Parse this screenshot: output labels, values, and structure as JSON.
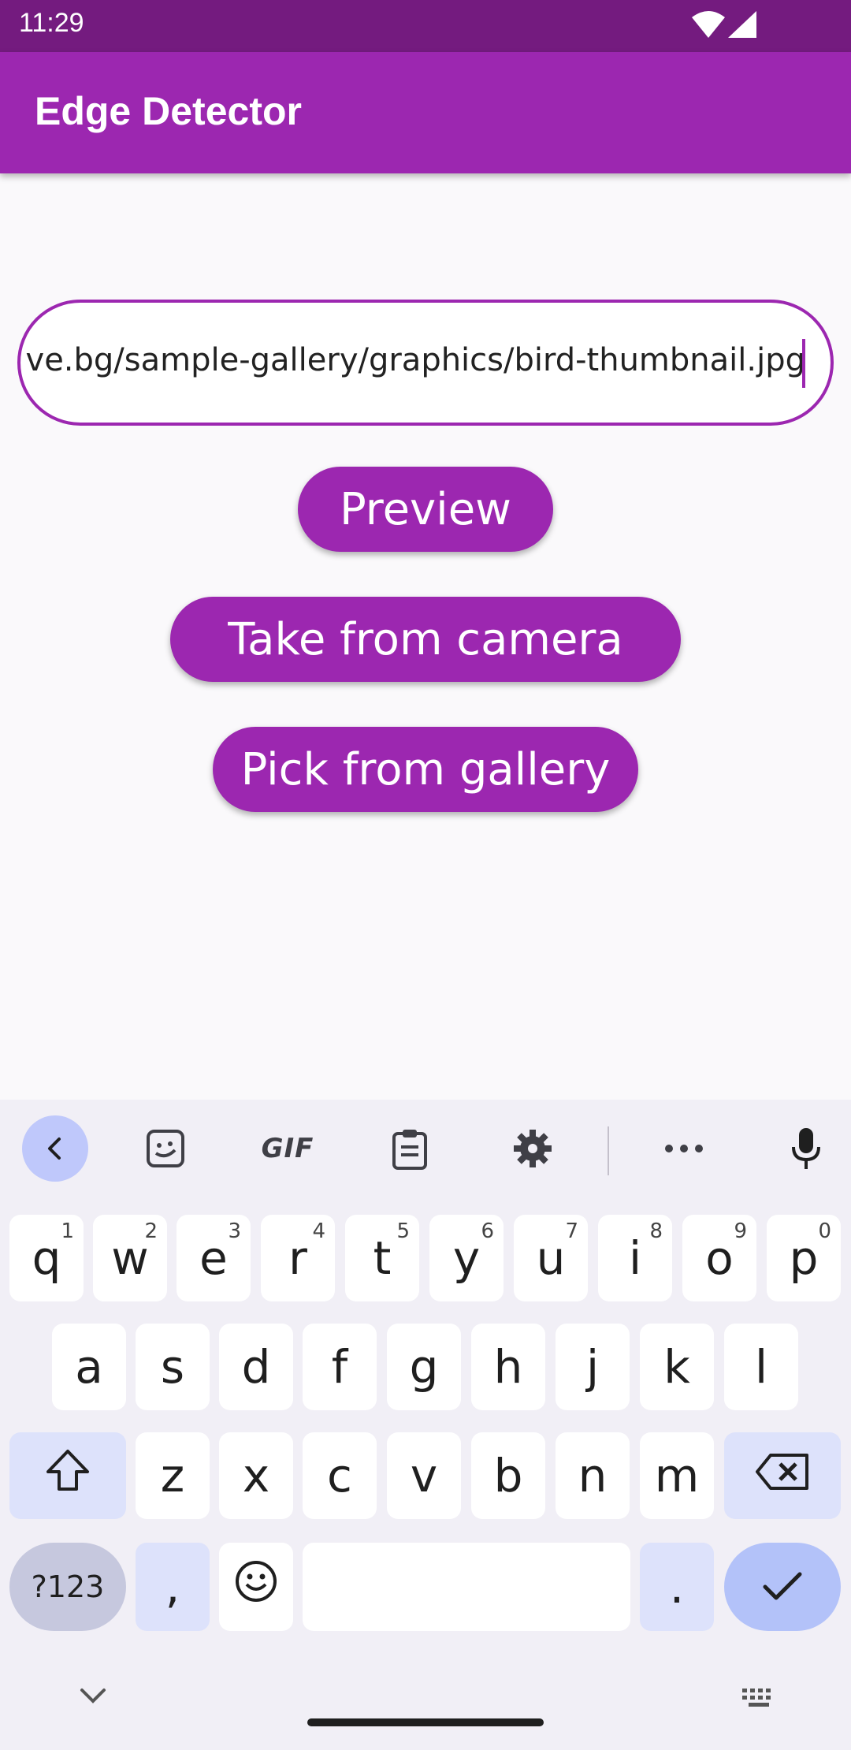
{
  "status_bar": {
    "time": "11:29",
    "wifi_icon": "wifi-icon",
    "signal_icon": "signal-icon"
  },
  "app_bar": {
    "title": "Edge Detector"
  },
  "url_input": {
    "value": "ve.bg/sample-gallery/graphics/bird-thumbnail.jpg"
  },
  "buttons": {
    "preview": "Preview",
    "camera": "Take from camera",
    "gallery": "Pick from gallery"
  },
  "colors": {
    "primary": "#9c27b0",
    "status_bar": "#741b7f",
    "background": "#faf9fb"
  },
  "keyboard": {
    "toolbar": {
      "items": [
        "back-icon",
        "sticker-icon",
        "gif",
        "clipboard-icon",
        "settings-icon",
        "more-icon",
        "microphone-icon"
      ],
      "gif_label": "GIF"
    },
    "row1": [
      {
        "label": "q",
        "hint": "1"
      },
      {
        "label": "w",
        "hint": "2"
      },
      {
        "label": "e",
        "hint": "3"
      },
      {
        "label": "r",
        "hint": "4"
      },
      {
        "label": "t",
        "hint": "5"
      },
      {
        "label": "y",
        "hint": "6"
      },
      {
        "label": "u",
        "hint": "7"
      },
      {
        "label": "i",
        "hint": "8"
      },
      {
        "label": "o",
        "hint": "9"
      },
      {
        "label": "p",
        "hint": "0"
      }
    ],
    "row2": [
      "a",
      "s",
      "d",
      "f",
      "g",
      "h",
      "j",
      "k",
      "l"
    ],
    "row3": [
      "z",
      "x",
      "c",
      "v",
      "b",
      "n",
      "m"
    ],
    "row4": {
      "symbols": "?123",
      "comma": ",",
      "period": "."
    }
  }
}
